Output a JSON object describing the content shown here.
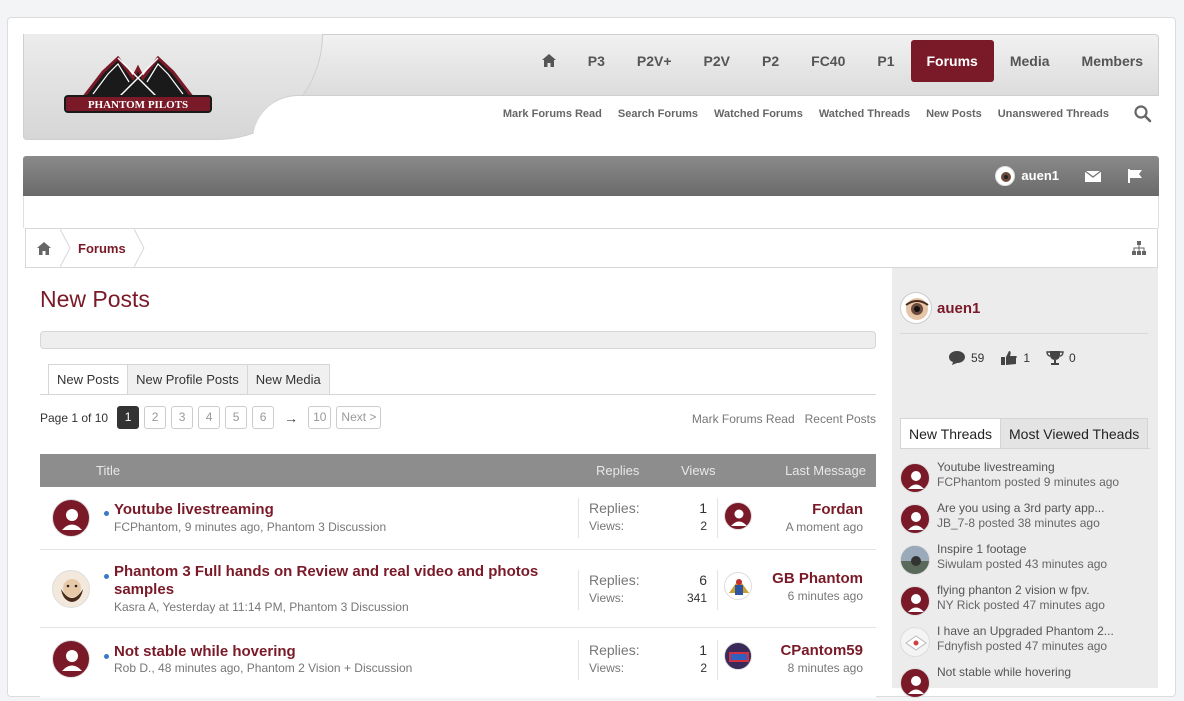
{
  "brand": {
    "logo_text": "PHANTOM PILOTS",
    "accent": "#7a1a28"
  },
  "nav": {
    "items": [
      "P3",
      "P2V+",
      "P2V",
      "P2",
      "FC40",
      "P1",
      "Forums",
      "Media",
      "Members"
    ],
    "active": "Forums"
  },
  "subnav": [
    "Mark Forums Read",
    "Search Forums",
    "Watched Forums",
    "Watched Threads",
    "New Posts",
    "Unanswered Threads"
  ],
  "userbar": {
    "username": "auen1"
  },
  "breadcrumb": {
    "current": "Forums"
  },
  "main": {
    "title": "New Posts",
    "tabs": [
      "New Posts",
      "New Profile Posts",
      "New Media"
    ],
    "pager": {
      "label": "Page 1 of 10",
      "pages": [
        "1",
        "2",
        "3",
        "4",
        "5",
        "6"
      ],
      "arrow": "→",
      "last": "10",
      "next": "Next >"
    },
    "links": [
      "Mark Forums Read",
      "Recent Posts"
    ],
    "columns": {
      "title": "Title",
      "replies": "Replies",
      "views": "Views",
      "last": "Last Message"
    },
    "stat_labels": {
      "replies": "Replies:",
      "views": "Views:"
    },
    "threads": [
      {
        "title": "Youtube livestreaming",
        "author": "FCPhantom",
        "time": "9 minutes ago",
        "forum": "Phantom 3 Discussion",
        "replies": "1",
        "views": "2",
        "last_user": "Fordan",
        "last_time": "A moment ago"
      },
      {
        "title": "Phantom 3 Full hands on Review and real video and photos samples",
        "author": "Kasra A",
        "time": "Yesterday at 11:14 PM",
        "forum": "Phantom 3 Discussion",
        "replies": "6",
        "views": "341",
        "last_user": "GB Phantom",
        "last_time": "6 minutes ago"
      },
      {
        "title": "Not stable while hovering",
        "author": "Rob D.",
        "time": "48 minutes ago",
        "forum": "Phantom 2 Vision + Discussion",
        "replies": "1",
        "views": "2",
        "last_user": "CPantom59",
        "last_time": "8 minutes ago"
      }
    ]
  },
  "sidebar": {
    "username": "auen1",
    "stats": {
      "messages": "59",
      "likes": "1",
      "trophies": "0"
    },
    "tabs": [
      "New Threads",
      "Most Viewed Theads"
    ],
    "threads": [
      {
        "title": "Youtube livestreaming",
        "meta": "FCPhantom posted 9 minutes ago"
      },
      {
        "title": "Are you using a 3rd party app...",
        "meta": "JB_7-8 posted 38 minutes ago"
      },
      {
        "title": "Inspire 1 footage",
        "meta": "Siwulam posted 43 minutes ago"
      },
      {
        "title": "flying phanton 2 vision w fpv.",
        "meta": "NY Rick posted 47 minutes ago"
      },
      {
        "title": "I have an Upgraded Phantom 2...",
        "meta": "Fdnyfish posted 47 minutes ago"
      },
      {
        "title": "Not stable while hovering",
        "meta": ""
      }
    ]
  }
}
